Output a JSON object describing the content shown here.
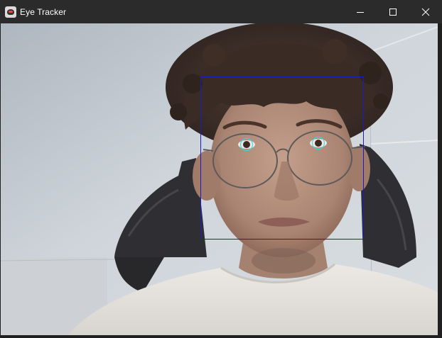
{
  "window": {
    "title": "Eye Tracker",
    "app_icon": "panda-icon",
    "controls": [
      "minimize",
      "maximize",
      "close"
    ]
  },
  "feed": {
    "face_detection": {
      "color": "#1a1ac8"
    },
    "eye_detections": {
      "count": 2,
      "color": "#20e0f0"
    }
  }
}
